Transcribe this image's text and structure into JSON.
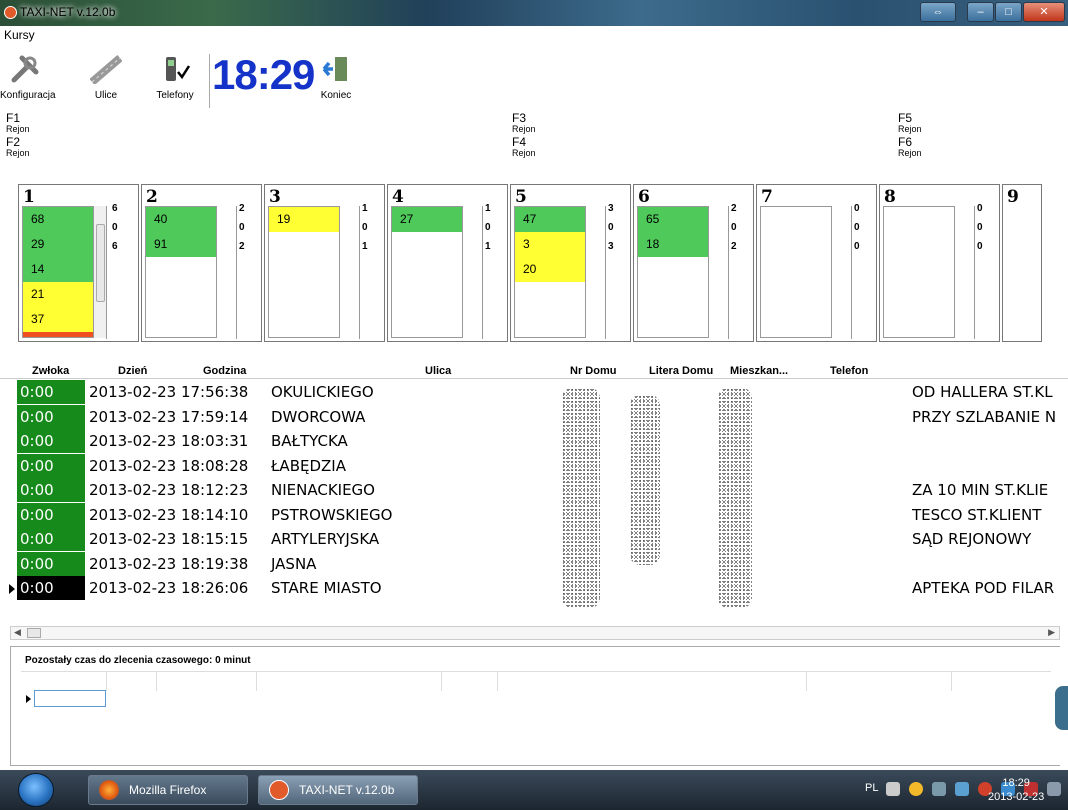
{
  "window": {
    "title": "TAXI-NET v.12.0b"
  },
  "menu": {
    "kursy": "Kursy"
  },
  "toolbar": {
    "konfiguracja": "Konfiguracja",
    "ulice": "Ulice",
    "telefony": "Telefony",
    "koniec": "Koniec"
  },
  "clock": "18:29",
  "fkeys": [
    {
      "key": "F1",
      "label": "Rejon"
    },
    {
      "key": "F2",
      "label": "Rejon"
    },
    {
      "key": "F3",
      "label": "Rejon"
    },
    {
      "key": "F4",
      "label": "Rejon"
    },
    {
      "key": "F5",
      "label": "Rejon"
    },
    {
      "key": "F6",
      "label": "Rejon"
    }
  ],
  "regions": [
    {
      "num": "1",
      "items": [
        {
          "v": "68",
          "c": "green"
        },
        {
          "v": "29",
          "c": "green"
        },
        {
          "v": "14",
          "c": "green"
        },
        {
          "v": "21",
          "c": "yellow"
        },
        {
          "v": "37",
          "c": "yellow"
        },
        {
          "v": "",
          "c": "orange"
        }
      ],
      "counts": [
        "6",
        "0",
        "6"
      ]
    },
    {
      "num": "2",
      "items": [
        {
          "v": "40",
          "c": "green"
        },
        {
          "v": "91",
          "c": "green"
        }
      ],
      "counts": [
        "2",
        "0",
        "2"
      ]
    },
    {
      "num": "3",
      "items": [
        {
          "v": "19",
          "c": "yellow"
        }
      ],
      "counts": [
        "1",
        "0",
        "1"
      ]
    },
    {
      "num": "4",
      "items": [
        {
          "v": "27",
          "c": "green"
        }
      ],
      "counts": [
        "1",
        "0",
        "1"
      ]
    },
    {
      "num": "5",
      "items": [
        {
          "v": "47",
          "c": "green"
        },
        {
          "v": "3",
          "c": "yellow"
        },
        {
          "v": "20",
          "c": "yellow"
        }
      ],
      "counts": [
        "3",
        "0",
        "3"
      ]
    },
    {
      "num": "6",
      "items": [
        {
          "v": "65",
          "c": "green"
        },
        {
          "v": "18",
          "c": "green"
        }
      ],
      "counts": [
        "2",
        "0",
        "2"
      ]
    },
    {
      "num": "7",
      "items": [],
      "counts": [
        "0",
        "0",
        "0"
      ]
    },
    {
      "num": "8",
      "items": [],
      "counts": [
        "0",
        "0",
        "0"
      ]
    },
    {
      "num": "9",
      "items": [],
      "counts": []
    }
  ],
  "grid": {
    "columns": {
      "zwloka": "Zwłoka",
      "dzien": "Dzień",
      "godzina": "Godzina",
      "ulica": "Ulica",
      "nr_domu": "Nr Domu",
      "litera_domu": "Litera Domu",
      "mieszkanie": "Mieszkan...",
      "telefon": "Telefon"
    },
    "rows": [
      {
        "zwloka": "0:00",
        "datetime": "2013-02-23 17:56:38",
        "ulica": "OKULICKIEGO",
        "note": "OD HALLERA ST.KL"
      },
      {
        "zwloka": "0:00",
        "datetime": "2013-02-23 17:59:14",
        "ulica": "DWORCOWA",
        "note": "PRZY SZLABANIE N"
      },
      {
        "zwloka": "0:00",
        "datetime": "2013-02-23 18:03:31",
        "ulica": "BAŁTYCKA",
        "note": ""
      },
      {
        "zwloka": "0:00",
        "datetime": "2013-02-23 18:08:28",
        "ulica": "ŁABĘDZIA",
        "note": ""
      },
      {
        "zwloka": "0:00",
        "datetime": "2013-02-23 18:12:23",
        "ulica": "NIENACKIEGO",
        "note": "ZA 10 MIN ST.KLIE"
      },
      {
        "zwloka": "0:00",
        "datetime": "2013-02-23 18:14:10",
        "ulica": "PSTROWSKIEGO",
        "note": "TESCO ST.KLIENT"
      },
      {
        "zwloka": "0:00",
        "datetime": "2013-02-23 18:15:15",
        "ulica": "ARTYLERYJSKA",
        "note": "SĄD REJONOWY"
      },
      {
        "zwloka": "0:00",
        "datetime": "2013-02-23 18:19:38",
        "ulica": "JASNA",
        "note": ""
      },
      {
        "zwloka": "0:00",
        "datetime": "2013-02-23 18:26:06",
        "ulica": "STARE MIASTO",
        "note": "APTEKA POD FILAR"
      }
    ]
  },
  "bottom": {
    "caption": "Pozostały czas do zlecenia czasowego: 0 minut"
  },
  "taskbar": {
    "firefox": "Mozilla Firefox",
    "taxinet": "TAXI-NET v.12.0b",
    "lang": "PL",
    "time": "18:29",
    "date": "2013-02-23"
  }
}
